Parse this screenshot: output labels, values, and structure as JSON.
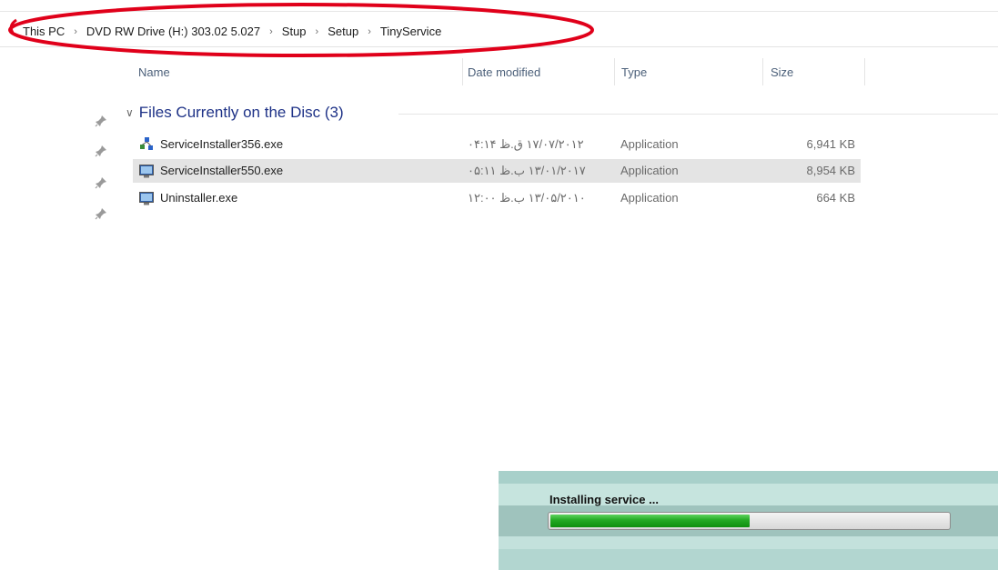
{
  "address": {
    "crumbs": [
      "This PC",
      "DVD RW Drive (H:) 303.02 5.027",
      "Stup",
      "Setup",
      "TinyService"
    ],
    "separator": "›",
    "highlight_color": "#e0001a"
  },
  "columns": {
    "name": "Name",
    "date_modified": "Date modified",
    "type": "Type",
    "size": "Size"
  },
  "group": {
    "label": "Files Currently on the Disc (3)"
  },
  "files": [
    {
      "name": "ServiceInstaller356.exe",
      "date": "۱۷/۰۷/۲۰۱۲ ق.ظ ۰۴:۱۴",
      "type": "Application",
      "size": "6,941 KB",
      "icon": "installer-icon",
      "selected": false
    },
    {
      "name": "ServiceInstaller550.exe",
      "date": "۱۳/۰۱/۲۰۱۷ ب.ظ ۰۵:۱۱",
      "type": "Application",
      "size": "8,954 KB",
      "icon": "monitor-app-icon",
      "selected": true
    },
    {
      "name": "Uninstaller.exe",
      "date": "۱۳/۰۵/۲۰۱۰ ب.ظ ۱۲:۰۰",
      "type": "Application",
      "size": "664 KB",
      "icon": "monitor-app-icon",
      "selected": false
    }
  ],
  "progress": {
    "title": "Installing service ...",
    "fraction": 0.5,
    "fill_color": "#23a823",
    "window_color": "#b5d8d2"
  }
}
